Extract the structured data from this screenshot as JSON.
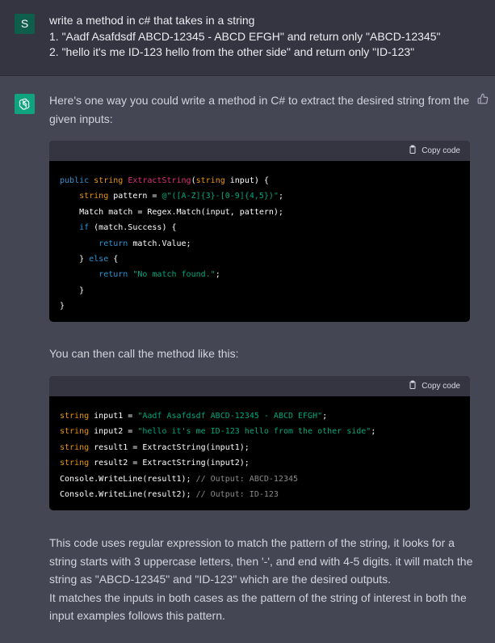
{
  "user": {
    "avatar_letter": "S",
    "lines": [
      "write a method in c# that takes in a string",
      "1.  \"Aadf Asafdsdf ABCD-12345 - ABCD EFGH\" and return only \"ABCD-12345\"",
      "2. \"hello it's me ID-123 hello from the other side\" and return only \"ID-123\""
    ]
  },
  "assistant": {
    "intro": "Here's one way you could write a method in C# to extract the desired string from the given inputs:",
    "copy_label": "Copy code",
    "code1": {
      "l1_kw": "public",
      "l1_ty": "string",
      "l1_fn": "ExtractString",
      "l1_a": "(",
      "l1_ty2": "string",
      "l1_b": " input) {",
      "l2_ty": "string",
      "l2_a": " pattern = ",
      "l2_st": "@\"([A-Z]{3}-[0-9]{4,5})\"",
      "l2_b": ";",
      "l3": "Match match = Regex.Match(input, pattern);",
      "l4_kw": "if",
      "l4_b": " (match.Success) {",
      "l5_kw": "return",
      "l5_b": " match.Value;",
      "l6_a": "} ",
      "l6_kw": "else",
      "l6_b": " {",
      "l7_kw": "return",
      "l7_a": " ",
      "l7_st": "\"No match found.\"",
      "l7_b": ";",
      "l8": "}",
      "l9": "}"
    },
    "call_text": "You can then call the method like this:",
    "code2": {
      "l1_ty": "string",
      "l1_a": " input1 = ",
      "l1_st": "\"Aadf Asafdsdf ABCD-12345 - ABCD EFGH\"",
      "l1_b": ";",
      "l2_ty": "string",
      "l2_a": " input2 = ",
      "l2_st": "\"hello it's me ID-123 hello from the other side\"",
      "l2_b": ";",
      "l3_ty": "string",
      "l3_a": " result1 = ExtractString(input1);",
      "l4_ty": "string",
      "l4_a": " result2 = ExtractString(input2);",
      "l5_a": "Console.WriteLine(result1); ",
      "l5_cm": "// Output: ABCD-12345",
      "l6_a": "Console.WriteLine(result2); ",
      "l6_cm": "// Output: ID-123"
    },
    "explanation": "This code uses regular expression to match the pattern of the string, it looks for a string starts with 3 uppercase letters, then '-', and end with 4-5 digits. it will match the string as \"ABCD-12345\" and \"ID-123\" which are the desired outputs.",
    "explanation2": "It matches the inputs in both cases as the pattern of the string of interest in both the input examples follows this pattern."
  },
  "colors": {
    "user_bg": "#343541",
    "assistant_bg": "#444654",
    "user_avatar": "#0f5e4b",
    "gpt_avatar": "#10a37f",
    "code_bg": "#000000",
    "code_header": "#343541"
  },
  "icons": [
    "openai-logo-icon",
    "thumbs-up-icon",
    "clipboard-icon"
  ]
}
